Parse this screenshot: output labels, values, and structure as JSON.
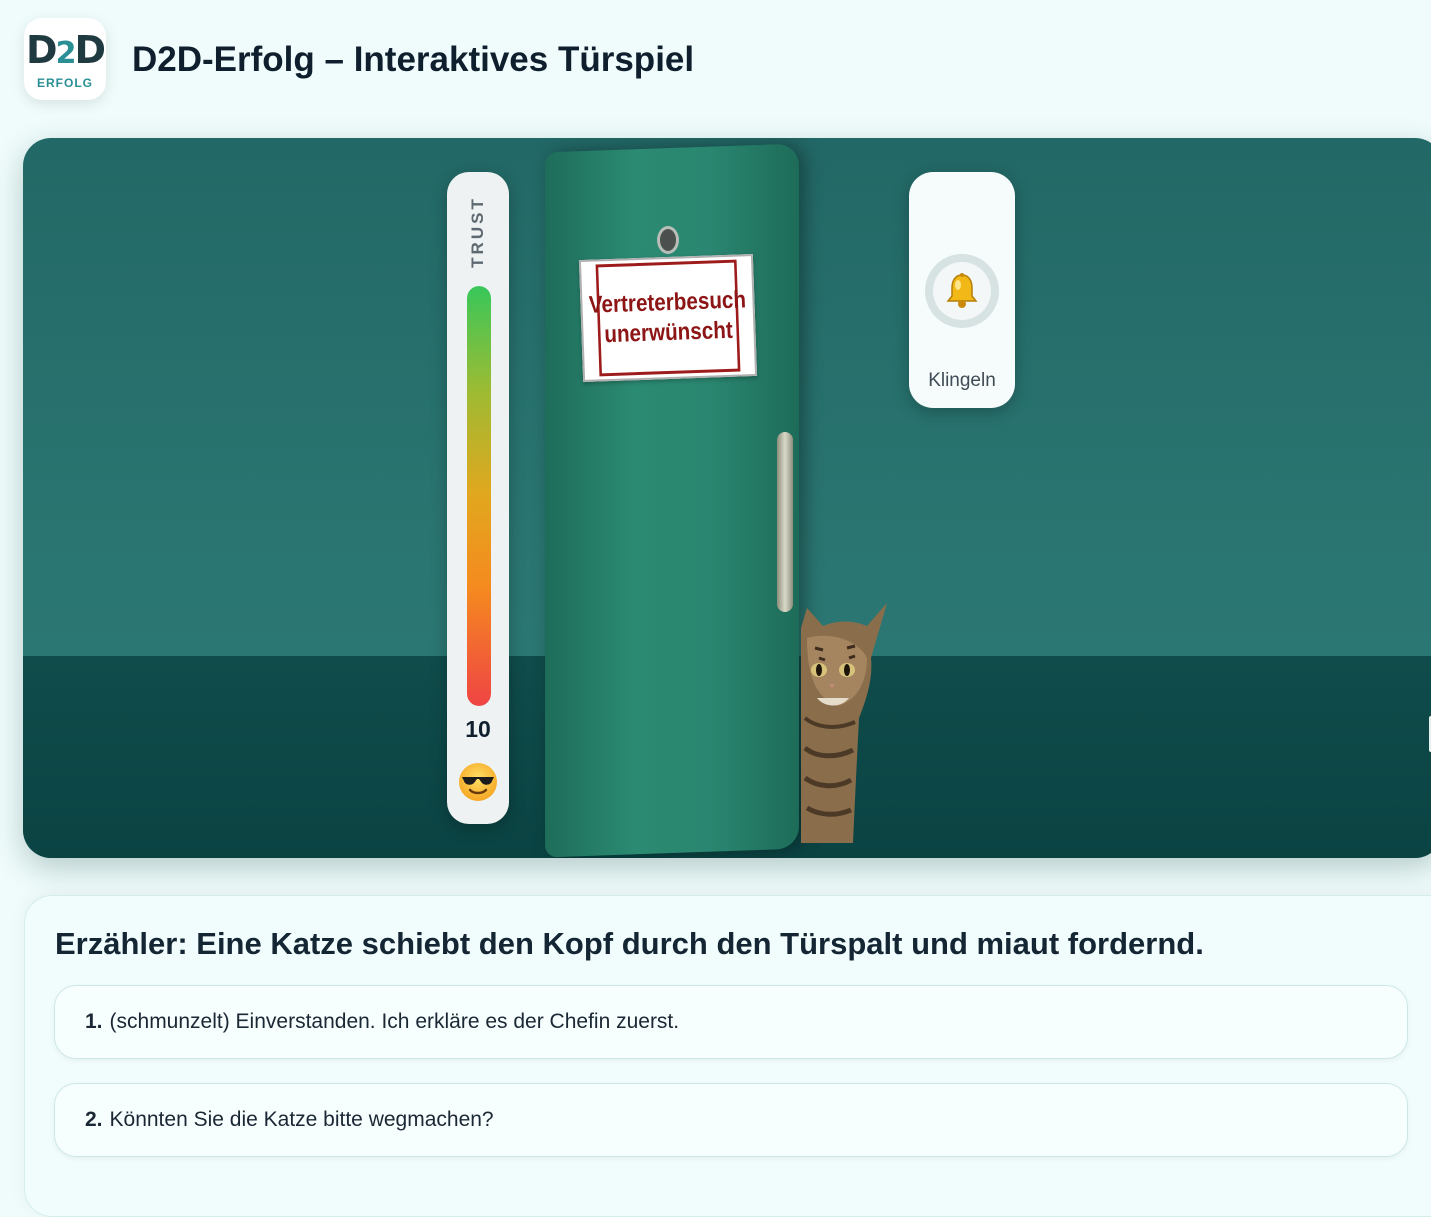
{
  "header": {
    "logo_mark_letter1": "D",
    "logo_mark_digit": "2",
    "logo_mark_letter2": "D",
    "logo_subtext": "ERFOLG",
    "title": "D2D-Erfolg – Interaktives Türspiel"
  },
  "scene": {
    "trust": {
      "label": "TRUST",
      "value": "10",
      "level_fraction": 1.0,
      "mood_icon": "smiling-face-with-sunglasses-icon"
    },
    "door_sign": {
      "line1": "Vertreterbesuch",
      "line2": "unerwünscht"
    },
    "bell": {
      "icon": "bell-icon",
      "label": "Klingeln"
    }
  },
  "dialogue": {
    "narration": "Erzähler: Eine Katze schiebt den Kopf durch den Türspalt und miaut fordernd.",
    "options": [
      {
        "number": "1.",
        "text": "(schmunzelt) Einverstanden. Ich erkläre es der Chefin zuerst."
      },
      {
        "number": "2.",
        "text": "Könnten Sie die Katze bitte wegmachen?"
      }
    ]
  },
  "colors": {
    "scene_wall": "#2a7571",
    "scene_floor": "#0f4c4b",
    "door": "#2b8a72",
    "sign_red": "#8d1515",
    "trust_high": "#38c75a",
    "trust_low": "#ef4444"
  }
}
